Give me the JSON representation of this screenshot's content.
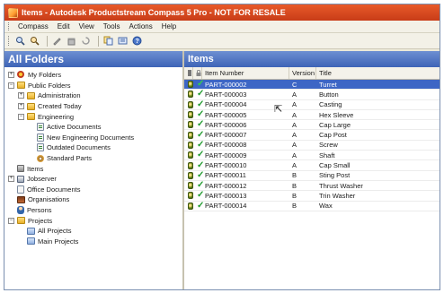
{
  "window": {
    "title": "Items - Autodesk Productstream Compass 5 Pro - NOT FOR RESALE"
  },
  "menu": [
    "Compass",
    "Edit",
    "View",
    "Tools",
    "Actions",
    "Help"
  ],
  "toolbar": {
    "icons": [
      "search-icon",
      "search-advanced-icon",
      "edit-icon",
      "delete-icon",
      "refresh-icon",
      "copy-icon",
      "properties-icon",
      "help-icon"
    ]
  },
  "left_pane": {
    "header": "All Folders",
    "tree": [
      {
        "label": "My Folders",
        "level": 1,
        "expander": "+",
        "icon": "star"
      },
      {
        "label": "Public Folders",
        "level": 1,
        "expander": "−",
        "icon": "folder"
      },
      {
        "label": "Administration",
        "level": 2,
        "expander": "+",
        "icon": "folder"
      },
      {
        "label": "Created Today",
        "level": 2,
        "expander": "+",
        "icon": "folder"
      },
      {
        "label": "Engineering",
        "level": 2,
        "expander": "−",
        "icon": "folder"
      },
      {
        "label": "Active Documents",
        "level": 3,
        "expander": "",
        "icon": "doc"
      },
      {
        "label": "New Engineering Documents",
        "level": 3,
        "expander": "",
        "icon": "doc"
      },
      {
        "label": "Outdated Documents",
        "level": 3,
        "expander": "",
        "icon": "doc"
      },
      {
        "label": "Standard Parts",
        "level": 3,
        "expander": "",
        "icon": "gear"
      },
      {
        "label": "Items",
        "level": 1,
        "expander": "",
        "icon": "items"
      },
      {
        "label": "Jobserver",
        "level": 1,
        "expander": "+",
        "icon": "job"
      },
      {
        "label": "Office Documents",
        "level": 1,
        "expander": "",
        "icon": "office"
      },
      {
        "label": "Organisations",
        "level": 1,
        "expander": "",
        "icon": "org"
      },
      {
        "label": "Persons",
        "level": 1,
        "expander": "",
        "icon": "person"
      },
      {
        "label": "Projects",
        "level": 1,
        "expander": "−",
        "icon": "folder"
      },
      {
        "label": "All Projects",
        "level": 2,
        "expander": "",
        "icon": "proj"
      },
      {
        "label": "Main Projects",
        "level": 2,
        "expander": "",
        "icon": "proj"
      }
    ]
  },
  "right_pane": {
    "header": "Items",
    "columns": {
      "number": "Item Number",
      "version": "Version",
      "title": "Title"
    },
    "rows": [
      {
        "number": "PART-000002",
        "version": "C",
        "title": "Turret",
        "selected": true
      },
      {
        "number": "PART-000003",
        "version": "A",
        "title": "Button",
        "selected": false
      },
      {
        "number": "PART-000004",
        "version": "A",
        "title": "Casting",
        "selected": false
      },
      {
        "number": "PART-000005",
        "version": "A",
        "title": "Hex Sleeve",
        "selected": false
      },
      {
        "number": "PART-000006",
        "version": "A",
        "title": "Cap Large",
        "selected": false
      },
      {
        "number": "PART-000007",
        "version": "A",
        "title": "Cap Post",
        "selected": false
      },
      {
        "number": "PART-000008",
        "version": "A",
        "title": "Screw",
        "selected": false
      },
      {
        "number": "PART-000009",
        "version": "A",
        "title": "Shaft",
        "selected": false
      },
      {
        "number": "PART-000010",
        "version": "A",
        "title": "Cap Small",
        "selected": false
      },
      {
        "number": "PART-000011",
        "version": "B",
        "title": "Sting Post",
        "selected": false
      },
      {
        "number": "PART-000012",
        "version": "B",
        "title": "Thrust Washer",
        "selected": false
      },
      {
        "number": "PART-000013",
        "version": "B",
        "title": "Trin Washer",
        "selected": false
      },
      {
        "number": "PART-000014",
        "version": "B",
        "title": "Wax",
        "selected": false
      }
    ]
  },
  "colors": {
    "title_bar": "#d64a1f",
    "pane_header": "#4b70c0",
    "selection": "#3d66c5",
    "status_check": "#1f9a2d"
  }
}
